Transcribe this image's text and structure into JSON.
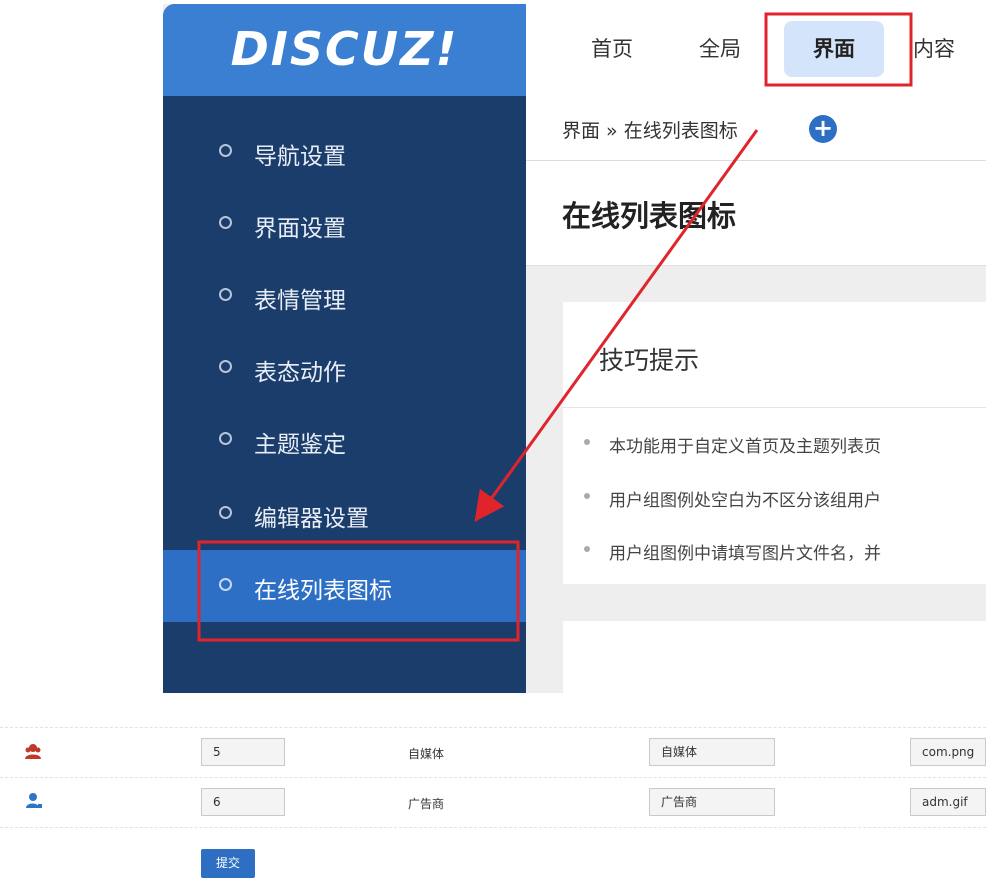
{
  "logo": "DISCUZ!",
  "topnav": {
    "tabs": [
      "首页",
      "全局",
      "界面",
      "内容"
    ],
    "active": "界面"
  },
  "sidebar": {
    "items": [
      "导航设置",
      "界面设置",
      "表情管理",
      "表态动作",
      "主题鉴定",
      "编辑器设置",
      "在线列表图标"
    ],
    "active": "在线列表图标"
  },
  "breadcrumb": {
    "text": "界面 » 在线列表图标",
    "add_icon": "+"
  },
  "page": {
    "title": "在线列表图标"
  },
  "tips": {
    "title": "技巧提示",
    "items": [
      "本功能用于自定义首页及主题列表页",
      "用户组图例处空白为不区分该组用户",
      "用户组图例中请填写图片文件名，并"
    ]
  },
  "table": {
    "rows": [
      {
        "icon": "we-media-user-icon",
        "order": "5",
        "name": "自媒体",
        "title": "自媒体",
        "file": "com.png",
        "icon_color": "#c0392b"
      },
      {
        "icon": "advertiser-user-icon",
        "order": "6",
        "name": "广告商",
        "title": "广告商",
        "file": "adm.gif",
        "icon_color": "#2a77c9"
      }
    ]
  },
  "submit_label": "提交",
  "colors": {
    "sidebar": "#1b3d6b",
    "logo_bar": "#3a7fd2",
    "accent": "#2d6fc4",
    "annotation": "#e0242c"
  }
}
